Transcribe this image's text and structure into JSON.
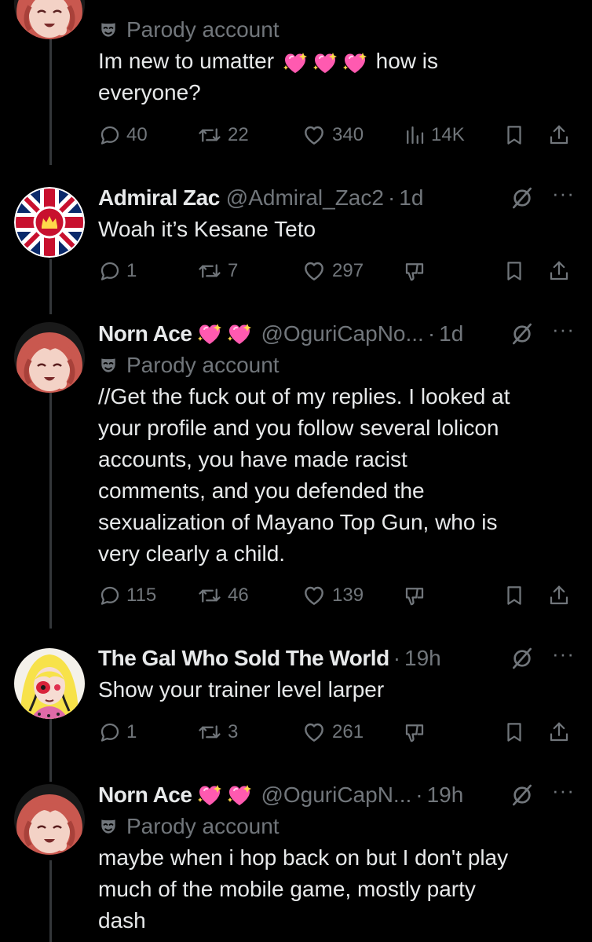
{
  "tweets": [
    {
      "parody_label": "Parody account",
      "text": "Im new to umatter 💖💖💖 how is everyone?",
      "text_line1_a": "Im new to umatter",
      "text_line1_b": "how is",
      "text_line2": "everyone?",
      "replies": "40",
      "reposts": "22",
      "likes": "340",
      "views": "14K"
    },
    {
      "name": "Admiral Zac",
      "handle": "@Admiral_Zac2",
      "time": "1d",
      "text": "Woah it’s Kesane Teto",
      "replies": "1",
      "reposts": "7",
      "likes": "297"
    },
    {
      "name": "Norn Ace",
      "handle": "@OguriCapNo...",
      "time": "1d",
      "parody_label": "Parody account",
      "text_lines": [
        "//Get the fuck out of my replies. I looked at",
        "your profile and you follow several lolicon",
        "accounts, you have made racist",
        "comments, and you defended the",
        "sexualization of Mayano Top Gun, who is",
        "very clearly a child."
      ],
      "replies": "115",
      "reposts": "46",
      "likes": "139"
    },
    {
      "name": "The Gal Who Sold The World",
      "time": "19h",
      "text": "Show your trainer level larper",
      "replies": "1",
      "reposts": "3",
      "likes": "261"
    },
    {
      "name": "Norn Ace",
      "handle": "@OguriCapN...",
      "time": "19h",
      "parody_label": "Parody account",
      "text_lines": [
        "maybe when i hop back on but I don't play",
        "much of the mobile game, mostly party",
        "dash"
      ]
    }
  ],
  "separator": "·",
  "more_glyph": "···",
  "icons": [
    "reply-icon",
    "repost-icon",
    "like-icon",
    "views-icon",
    "bookmark-icon",
    "share-icon",
    "grok-icon",
    "more-icon",
    "parody-mask-icon",
    "sparkling-heart-emoji",
    "downvote-icon"
  ],
  "colors": {
    "background": "#000000",
    "text": "#e7e9ea",
    "secondary": "#71767b",
    "thread_line": "#333639"
  }
}
